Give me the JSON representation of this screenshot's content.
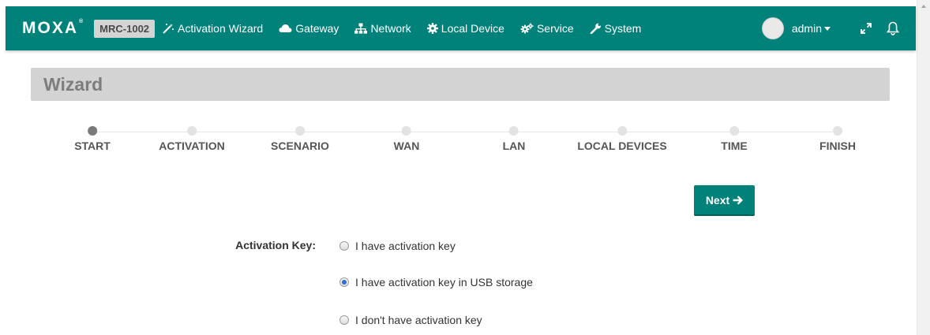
{
  "brand": {
    "logo": "MOXA",
    "logo_mark": "®"
  },
  "header": {
    "model": "MRC-1002",
    "nav": [
      {
        "label": "Activation Wizard",
        "icon": "magic-wand-icon"
      },
      {
        "label": "Gateway",
        "icon": "cloud-icon"
      },
      {
        "label": "Network",
        "icon": "network-icon"
      },
      {
        "label": "Local Device",
        "icon": "cog-icon"
      },
      {
        "label": "Service",
        "icon": "cogs-icon"
      },
      {
        "label": "System",
        "icon": "wrench-icon"
      }
    ],
    "user": "admin"
  },
  "wizard": {
    "title": "Wizard",
    "steps": [
      "START",
      "ACTIVATION",
      "SCENARIO",
      "WAN",
      "LAN",
      "LOCAL DEVICES",
      "TIME",
      "FINISH"
    ],
    "active_step": 0,
    "next_label": "Next"
  },
  "form": {
    "label": "Activation Key:",
    "options": [
      {
        "label": "I have activation key",
        "checked": false
      },
      {
        "label": "I have activation key in USB storage",
        "checked": true
      },
      {
        "label": "I don't have activation key",
        "checked": false
      }
    ]
  },
  "colors": {
    "primary": "#00817a",
    "header_bar": "#d3d3d3",
    "radio_selected": "#2d6fcf"
  }
}
